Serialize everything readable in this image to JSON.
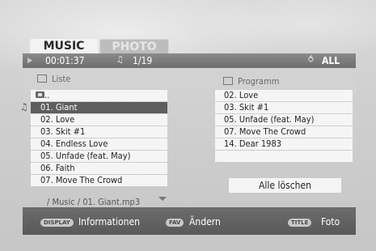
{
  "tabs": {
    "music": "MUSIC",
    "photo": "PHOTO"
  },
  "status": {
    "time": "00:01:37",
    "track": "1/19",
    "repeat": "ALL"
  },
  "file_list": {
    "title": "Liste",
    "items": [
      "..",
      "01. Giant",
      "02. Love",
      "03. Skit #1",
      "04. Endless Love",
      "05. Unfade (feat. May)",
      "06. Faith",
      "07. Move The Crowd"
    ],
    "selected_index": 1,
    "path": "/ Music / 01. Giant.mp3"
  },
  "program": {
    "title": "Programm",
    "items": [
      "02. Love",
      "03. Skit #1",
      "05. Unfade (feat. May)",
      "07. Move The Crowd",
      "14. Dear 1983"
    ],
    "clear_label": "Alle löschen"
  },
  "footer": {
    "display_key": "DISPLAY",
    "display_label": "Informationen",
    "fav_key": "FAV",
    "fav_label": "Ändern",
    "title_key": "TITLE",
    "title_label": "Foto"
  }
}
